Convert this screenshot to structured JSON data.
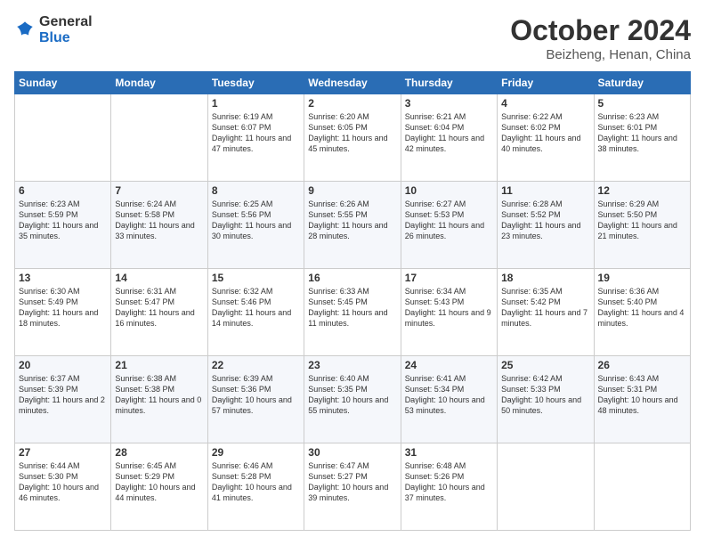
{
  "header": {
    "logo": {
      "general": "General",
      "blue": "Blue"
    },
    "title": "October 2024",
    "location": "Beizheng, Henan, China"
  },
  "calendar": {
    "days": [
      "Sunday",
      "Monday",
      "Tuesday",
      "Wednesday",
      "Thursday",
      "Friday",
      "Saturday"
    ],
    "weeks": [
      [
        {
          "day": null,
          "sunrise": null,
          "sunset": null,
          "daylight": null
        },
        {
          "day": null,
          "sunrise": null,
          "sunset": null,
          "daylight": null
        },
        {
          "day": 1,
          "sunrise": "6:19 AM",
          "sunset": "6:07 PM",
          "daylight": "11 hours and 47 minutes."
        },
        {
          "day": 2,
          "sunrise": "6:20 AM",
          "sunset": "6:05 PM",
          "daylight": "11 hours and 45 minutes."
        },
        {
          "day": 3,
          "sunrise": "6:21 AM",
          "sunset": "6:04 PM",
          "daylight": "11 hours and 42 minutes."
        },
        {
          "day": 4,
          "sunrise": "6:22 AM",
          "sunset": "6:02 PM",
          "daylight": "11 hours and 40 minutes."
        },
        {
          "day": 5,
          "sunrise": "6:23 AM",
          "sunset": "6:01 PM",
          "daylight": "11 hours and 38 minutes."
        }
      ],
      [
        {
          "day": 6,
          "sunrise": "6:23 AM",
          "sunset": "5:59 PM",
          "daylight": "11 hours and 35 minutes."
        },
        {
          "day": 7,
          "sunrise": "6:24 AM",
          "sunset": "5:58 PM",
          "daylight": "11 hours and 33 minutes."
        },
        {
          "day": 8,
          "sunrise": "6:25 AM",
          "sunset": "5:56 PM",
          "daylight": "11 hours and 30 minutes."
        },
        {
          "day": 9,
          "sunrise": "6:26 AM",
          "sunset": "5:55 PM",
          "daylight": "11 hours and 28 minutes."
        },
        {
          "day": 10,
          "sunrise": "6:27 AM",
          "sunset": "5:53 PM",
          "daylight": "11 hours and 26 minutes."
        },
        {
          "day": 11,
          "sunrise": "6:28 AM",
          "sunset": "5:52 PM",
          "daylight": "11 hours and 23 minutes."
        },
        {
          "day": 12,
          "sunrise": "6:29 AM",
          "sunset": "5:50 PM",
          "daylight": "11 hours and 21 minutes."
        }
      ],
      [
        {
          "day": 13,
          "sunrise": "6:30 AM",
          "sunset": "5:49 PM",
          "daylight": "11 hours and 18 minutes."
        },
        {
          "day": 14,
          "sunrise": "6:31 AM",
          "sunset": "5:47 PM",
          "daylight": "11 hours and 16 minutes."
        },
        {
          "day": 15,
          "sunrise": "6:32 AM",
          "sunset": "5:46 PM",
          "daylight": "11 hours and 14 minutes."
        },
        {
          "day": 16,
          "sunrise": "6:33 AM",
          "sunset": "5:45 PM",
          "daylight": "11 hours and 11 minutes."
        },
        {
          "day": 17,
          "sunrise": "6:34 AM",
          "sunset": "5:43 PM",
          "daylight": "11 hours and 9 minutes."
        },
        {
          "day": 18,
          "sunrise": "6:35 AM",
          "sunset": "5:42 PM",
          "daylight": "11 hours and 7 minutes."
        },
        {
          "day": 19,
          "sunrise": "6:36 AM",
          "sunset": "5:40 PM",
          "daylight": "11 hours and 4 minutes."
        }
      ],
      [
        {
          "day": 20,
          "sunrise": "6:37 AM",
          "sunset": "5:39 PM",
          "daylight": "11 hours and 2 minutes."
        },
        {
          "day": 21,
          "sunrise": "6:38 AM",
          "sunset": "5:38 PM",
          "daylight": "11 hours and 0 minutes."
        },
        {
          "day": 22,
          "sunrise": "6:39 AM",
          "sunset": "5:36 PM",
          "daylight": "10 hours and 57 minutes."
        },
        {
          "day": 23,
          "sunrise": "6:40 AM",
          "sunset": "5:35 PM",
          "daylight": "10 hours and 55 minutes."
        },
        {
          "day": 24,
          "sunrise": "6:41 AM",
          "sunset": "5:34 PM",
          "daylight": "10 hours and 53 minutes."
        },
        {
          "day": 25,
          "sunrise": "6:42 AM",
          "sunset": "5:33 PM",
          "daylight": "10 hours and 50 minutes."
        },
        {
          "day": 26,
          "sunrise": "6:43 AM",
          "sunset": "5:31 PM",
          "daylight": "10 hours and 48 minutes."
        }
      ],
      [
        {
          "day": 27,
          "sunrise": "6:44 AM",
          "sunset": "5:30 PM",
          "daylight": "10 hours and 46 minutes."
        },
        {
          "day": 28,
          "sunrise": "6:45 AM",
          "sunset": "5:29 PM",
          "daylight": "10 hours and 44 minutes."
        },
        {
          "day": 29,
          "sunrise": "6:46 AM",
          "sunset": "5:28 PM",
          "daylight": "10 hours and 41 minutes."
        },
        {
          "day": 30,
          "sunrise": "6:47 AM",
          "sunset": "5:27 PM",
          "daylight": "10 hours and 39 minutes."
        },
        {
          "day": 31,
          "sunrise": "6:48 AM",
          "sunset": "5:26 PM",
          "daylight": "10 hours and 37 minutes."
        },
        {
          "day": null,
          "sunrise": null,
          "sunset": null,
          "daylight": null
        },
        {
          "day": null,
          "sunrise": null,
          "sunset": null,
          "daylight": null
        }
      ]
    ]
  }
}
